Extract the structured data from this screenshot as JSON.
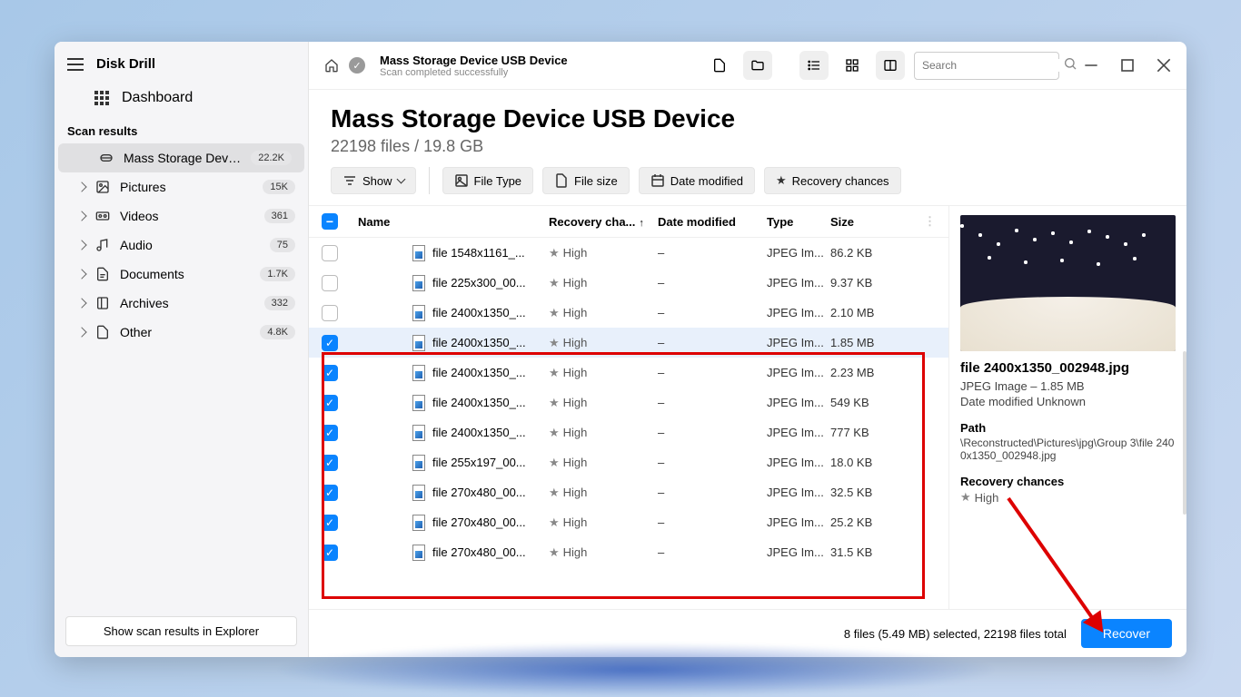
{
  "app": {
    "title": "Disk Drill",
    "dashboard": "Dashboard"
  },
  "sidebar": {
    "section": "Scan results",
    "items": [
      {
        "label": "Mass Storage Device U...",
        "badge": "22.2K"
      },
      {
        "label": "Pictures",
        "badge": "15K"
      },
      {
        "label": "Videos",
        "badge": "361"
      },
      {
        "label": "Audio",
        "badge": "75"
      },
      {
        "label": "Documents",
        "badge": "1.7K"
      },
      {
        "label": "Archives",
        "badge": "332"
      },
      {
        "label": "Other",
        "badge": "4.8K"
      }
    ],
    "footer_btn": "Show scan results in Explorer"
  },
  "top": {
    "title": "Mass Storage Device USB Device",
    "subtitle": "Scan completed successfully",
    "search_placeholder": "Search"
  },
  "header": {
    "title": "Mass Storage Device USB Device",
    "subtitle": "22198 files / 19.8 GB"
  },
  "filters": {
    "show": "Show",
    "file_type": "File Type",
    "file_size": "File size",
    "date_modified": "Date modified",
    "recovery_chances": "Recovery chances"
  },
  "table": {
    "cols": {
      "name": "Name",
      "recovery": "Recovery cha...",
      "date": "Date modified",
      "type": "Type",
      "size": "Size"
    },
    "rows": [
      {
        "chk": false,
        "name": "file 1548x1161_...",
        "rec": "High",
        "date": "–",
        "type": "JPEG Im...",
        "size": "86.2 KB"
      },
      {
        "chk": false,
        "name": "file 225x300_00...",
        "rec": "High",
        "date": "–",
        "type": "JPEG Im...",
        "size": "9.37 KB"
      },
      {
        "chk": false,
        "name": "file 2400x1350_...",
        "rec": "High",
        "date": "–",
        "type": "JPEG Im...",
        "size": "2.10 MB"
      },
      {
        "chk": true,
        "name": "file 2400x1350_...",
        "rec": "High",
        "date": "–",
        "type": "JPEG Im...",
        "size": "1.85 MB",
        "hl": true
      },
      {
        "chk": true,
        "name": "file 2400x1350_...",
        "rec": "High",
        "date": "–",
        "type": "JPEG Im...",
        "size": "2.23 MB"
      },
      {
        "chk": true,
        "name": "file 2400x1350_...",
        "rec": "High",
        "date": "–",
        "type": "JPEG Im...",
        "size": "549 KB"
      },
      {
        "chk": true,
        "name": "file 2400x1350_...",
        "rec": "High",
        "date": "–",
        "type": "JPEG Im...",
        "size": "777 KB"
      },
      {
        "chk": true,
        "name": "file 255x197_00...",
        "rec": "High",
        "date": "–",
        "type": "JPEG Im...",
        "size": "18.0 KB"
      },
      {
        "chk": true,
        "name": "file 270x480_00...",
        "rec": "High",
        "date": "–",
        "type": "JPEG Im...",
        "size": "32.5 KB"
      },
      {
        "chk": true,
        "name": "file 270x480_00...",
        "rec": "High",
        "date": "–",
        "type": "JPEG Im...",
        "size": "25.2 KB"
      },
      {
        "chk": true,
        "name": "file 270x480_00...",
        "rec": "High",
        "date": "–",
        "type": "JPEG Im...",
        "size": "31.5 KB"
      }
    ]
  },
  "preview": {
    "title": "file 2400x1350_002948.jpg",
    "meta": "JPEG Image – 1.85 MB",
    "date": "Date modified Unknown",
    "path_label": "Path",
    "path": "\\Reconstructed\\Pictures\\jpg\\Group 3\\file 2400x1350_002948.jpg",
    "rc_label": "Recovery chances",
    "rc_value": "High"
  },
  "footer": {
    "status": "8 files (5.49 MB) selected, 22198 files total",
    "recover": "Recover"
  }
}
